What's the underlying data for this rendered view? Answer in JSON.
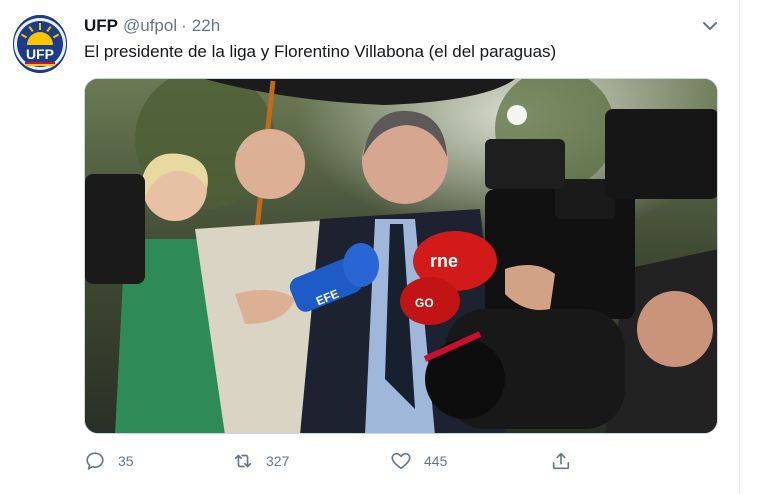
{
  "tweet": {
    "display_name": "UFP",
    "handle": "@ufpol",
    "separator": "·",
    "time": "22h",
    "text": "El presidente de la liga y Florentino Villabona (el del paraguas)",
    "avatar_text": "UFP"
  },
  "photo": {
    "mic_label_1": "rne",
    "mic_label_2": "EFE",
    "mic_label_3": "GO"
  },
  "actions": {
    "reply": {
      "icon": "reply-icon",
      "count": "35"
    },
    "retweet": {
      "icon": "retweet-icon",
      "count": "327"
    },
    "like": {
      "icon": "like-icon",
      "count": "445"
    },
    "share": {
      "icon": "share-icon"
    }
  },
  "colors": {
    "text_primary": "#14171a",
    "text_secondary": "#657786",
    "border": "#ccd6dd",
    "avatar_bg": "#1d3c88",
    "avatar_sun": "#f7c600"
  }
}
